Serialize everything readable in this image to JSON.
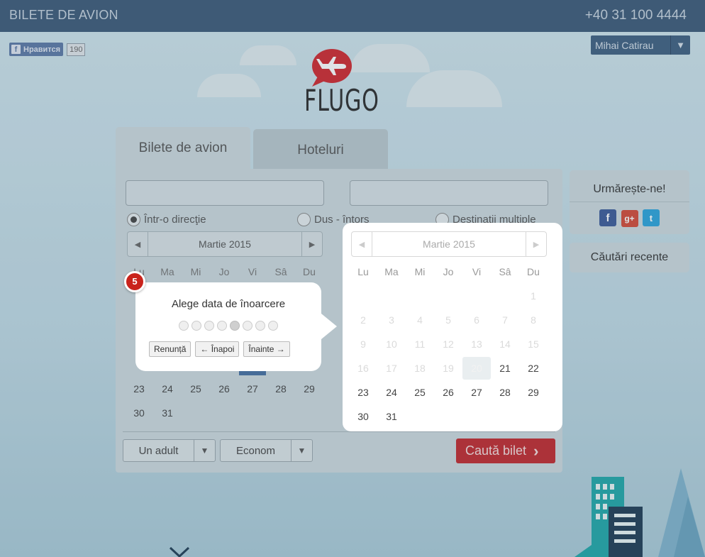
{
  "header": {
    "title": "BILETE DE AVION",
    "phone": "+40 31 100 4444"
  },
  "facebook": {
    "like_label": "Нравится",
    "like_count": "190"
  },
  "user": {
    "name": "Mihai Catirau"
  },
  "logo": {
    "text": "FLUGO"
  },
  "tabs": [
    {
      "label": "Bilete de avion"
    },
    {
      "label": "Hoteluri"
    }
  ],
  "trip_type": {
    "options": [
      "Într-o direcţie",
      "Dus - întors",
      "Destinaţii multiple"
    ],
    "selected": "Într-o direcţie"
  },
  "calendar_left": {
    "month": "Martie 2015",
    "weekdays": [
      "Lu",
      "Ma",
      "Mi",
      "Jo",
      "Vi",
      "Sâ",
      "Du"
    ],
    "visible_rows": [
      [
        "23",
        "24",
        "25",
        "26",
        "27",
        "28",
        "29"
      ],
      [
        "30",
        "31",
        "",
        "",
        "",
        "",
        ""
      ]
    ]
  },
  "calendar_popup": {
    "month": "Martie 2015",
    "weekdays": [
      "Lu",
      "Ma",
      "Mi",
      "Jo",
      "Vi",
      "Sâ",
      "Du"
    ],
    "rows": [
      [
        "",
        "",
        "",
        "",
        "",
        "",
        "1"
      ],
      [
        "2",
        "3",
        "4",
        "5",
        "6",
        "7",
        "8"
      ],
      [
        "9",
        "10",
        "11",
        "12",
        "13",
        "14",
        "15"
      ],
      [
        "16",
        "17",
        "18",
        "19",
        "20",
        "21",
        "22"
      ],
      [
        "23",
        "24",
        "25",
        "26",
        "27",
        "28",
        "29"
      ],
      [
        "30",
        "31",
        "",
        "",
        "",
        "",
        ""
      ]
    ],
    "today": "20"
  },
  "tour": {
    "step": "5",
    "message": "Alege data de înoarcere",
    "total_steps": 8,
    "current_step_index": 5,
    "cancel": "Renunță",
    "back": "← Înapoi",
    "next": "Înainte →"
  },
  "passengers": {
    "value": "Un adult"
  },
  "class": {
    "value": "Econom"
  },
  "search_button": {
    "label": "Caută bilet"
  },
  "sidebar": {
    "follow_title": "Urmărește-ne!",
    "social": [
      "facebook-icon",
      "google-plus-icon",
      "twitter-icon"
    ],
    "recent_searches": "Căutări recente"
  },
  "colors": {
    "topbar": "#3b5877",
    "accent_red": "#c1282d",
    "facebook": "#3b5998",
    "google": "#d34836",
    "twitter": "#2aa3db"
  }
}
